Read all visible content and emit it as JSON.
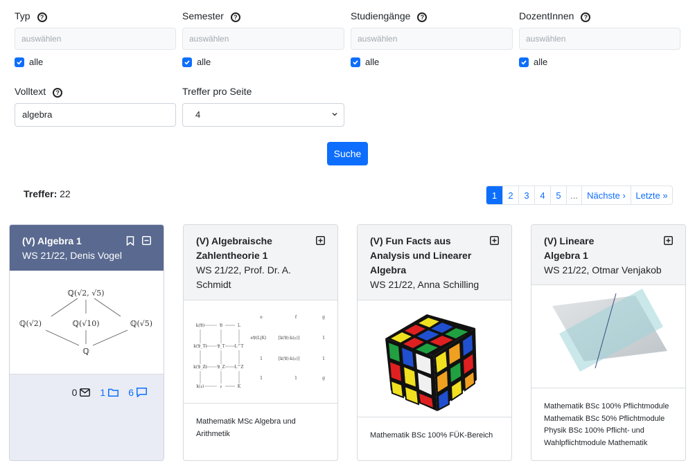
{
  "filters": {
    "typ": {
      "label": "Typ",
      "placeholder": "auswählen",
      "all": "alle"
    },
    "semester": {
      "label": "Semester",
      "placeholder": "auswählen",
      "all": "alle"
    },
    "studiengaenge": {
      "label": "Studiengänge",
      "placeholder": "auswählen",
      "all": "alle"
    },
    "dozentinnen": {
      "label": "DozentInnen",
      "placeholder": "auswählen",
      "all": "alle"
    },
    "volltext": {
      "label": "Volltext",
      "value": "algebra"
    },
    "treffer_pro_seite": {
      "label": "Treffer pro Seite",
      "value": "4"
    }
  },
  "search_button": "Suche",
  "hits": {
    "label": "Treffer:",
    "count": "22"
  },
  "pagination": {
    "pages": [
      "1",
      "2",
      "3",
      "4",
      "5"
    ],
    "active": "1",
    "ellipsis": "...",
    "next": "Nächste ›",
    "last": "Letzte »"
  },
  "cards": [
    {
      "title": "(V) Algebra 1",
      "subtitle": "WS 21/22, Denis Vogel",
      "image": "field-extension-lattice-diagram",
      "stats": {
        "messages": "0",
        "folders": "1",
        "comments": "6"
      }
    },
    {
      "title": "(V) Algebraische Zahlentheorie 1",
      "subtitle": "WS 21/22, Prof. Dr. A. Schmidt",
      "image": "commutative-diagram-table",
      "footer": "Mathematik MSc Algebra und Arithmetik"
    },
    {
      "title": "(V) Fun Facts aus Analysis und Linearer Algebra",
      "subtitle": "WS 21/22, Anna Schilling",
      "image": "rubiks-cube",
      "footer": "Mathematik BSc 100% FÜK-Bereich"
    },
    {
      "title": "(V) Lineare Algebra 1",
      "subtitle": "WS 21/22, Otmar Venjakob",
      "image": "intersecting-planes",
      "footer_lines": [
        "Mathematik BSc 100% Pflichtmodule",
        "Mathematik BSc 50% Pflichtmodule",
        "Physik BSc 100% Pflicht- und Wahlpflichtmodule Mathematik"
      ]
    }
  ],
  "diagram_labels": {
    "top": "ℚ(√2, √5)",
    "left": "ℚ(√2)",
    "mid": "ℚ(√10)",
    "right": "ℚ(√5)",
    "bottom": "ℚ"
  },
  "colors": {
    "primary": "#0d6efd",
    "active_header": "#59698f",
    "active_card_bg": "#e9ecf4"
  }
}
